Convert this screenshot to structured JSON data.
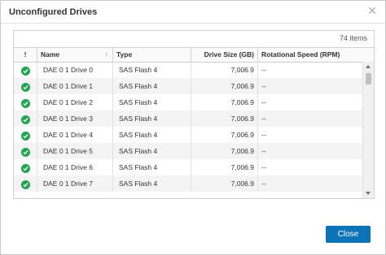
{
  "dialog": {
    "title": "Unconfigured Drives",
    "close_icon": "close-icon",
    "item_count": "74 items",
    "close_button": "Close"
  },
  "columns": {
    "status": "!",
    "name": "Name",
    "type": "Type",
    "size": "Drive Size (GB)",
    "speed": "Rotational Speed (RPM)"
  },
  "rows": [
    {
      "name": "DAE 0 1 Drive 0",
      "type": "SAS Flash 4",
      "size": "7,006.9",
      "speed": "--"
    },
    {
      "name": "DAE 0 1 Drive 1",
      "type": "SAS Flash 4",
      "size": "7,006.9",
      "speed": "--"
    },
    {
      "name": "DAE 0 1 Drive 2",
      "type": "SAS Flash 4",
      "size": "7,006.9",
      "speed": "--"
    },
    {
      "name": "DAE 0 1 Drive 3",
      "type": "SAS Flash 4",
      "size": "7,006.9",
      "speed": "--"
    },
    {
      "name": "DAE 0 1 Drive 4",
      "type": "SAS Flash 4",
      "size": "7,006.9",
      "speed": "--"
    },
    {
      "name": "DAE 0 1 Drive 5",
      "type": "SAS Flash 4",
      "size": "7,006.9",
      "speed": "--"
    },
    {
      "name": "DAE 0 1 Drive 6",
      "type": "SAS Flash 4",
      "size": "7,006.9",
      "speed": "--"
    },
    {
      "name": "DAE 0 1 Drive 7",
      "type": "SAS Flash 4",
      "size": "7,006.9",
      "speed": "--"
    }
  ],
  "colors": {
    "ok": "#22a552",
    "primary": "#0b73b7"
  }
}
